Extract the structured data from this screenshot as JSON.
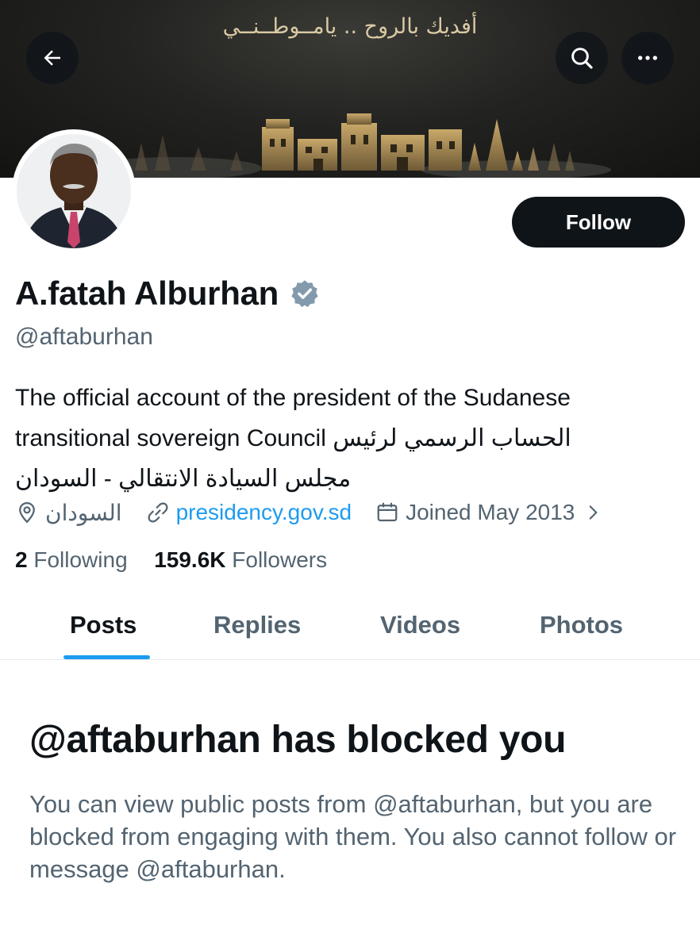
{
  "banner": {
    "text": "أفديك بالروح .. يامــوطــنــي"
  },
  "header": {
    "back_icon": "arrow-left-icon",
    "search_icon": "search-icon",
    "more_icon": "more-horizontal-icon"
  },
  "profile": {
    "name": "A.fatah Alburhan",
    "handle": "@aftaburhan",
    "verified_color": "#829aab",
    "follow_label": "Follow",
    "bio_lines": [
      "The official account of the president of the Sudanese",
      "الحساب الرسمي لرئيس transitional sovereign Council",
      "مجلس السيادة الانتقالي - السودان"
    ],
    "location": "السودان",
    "website": "presidency.gov.sd",
    "joined": "Joined May 2013",
    "following_count": "2",
    "following_label": "Following",
    "followers_count": "159.6K",
    "followers_label": "Followers"
  },
  "tabs": [
    {
      "label": "Posts",
      "active": true
    },
    {
      "label": "Replies",
      "active": false
    },
    {
      "label": "Videos",
      "active": false
    },
    {
      "label": "Photos",
      "active": false
    }
  ],
  "blocked": {
    "title": "@aftaburhan has blocked you",
    "message": "You can view public posts from @aftaburhan, but you are blocked from engaging with them. You also cannot follow or message @aftaburhan."
  },
  "colors": {
    "accent": "#1d9bf0",
    "text_primary": "#0f1419",
    "text_secondary": "#536471"
  }
}
